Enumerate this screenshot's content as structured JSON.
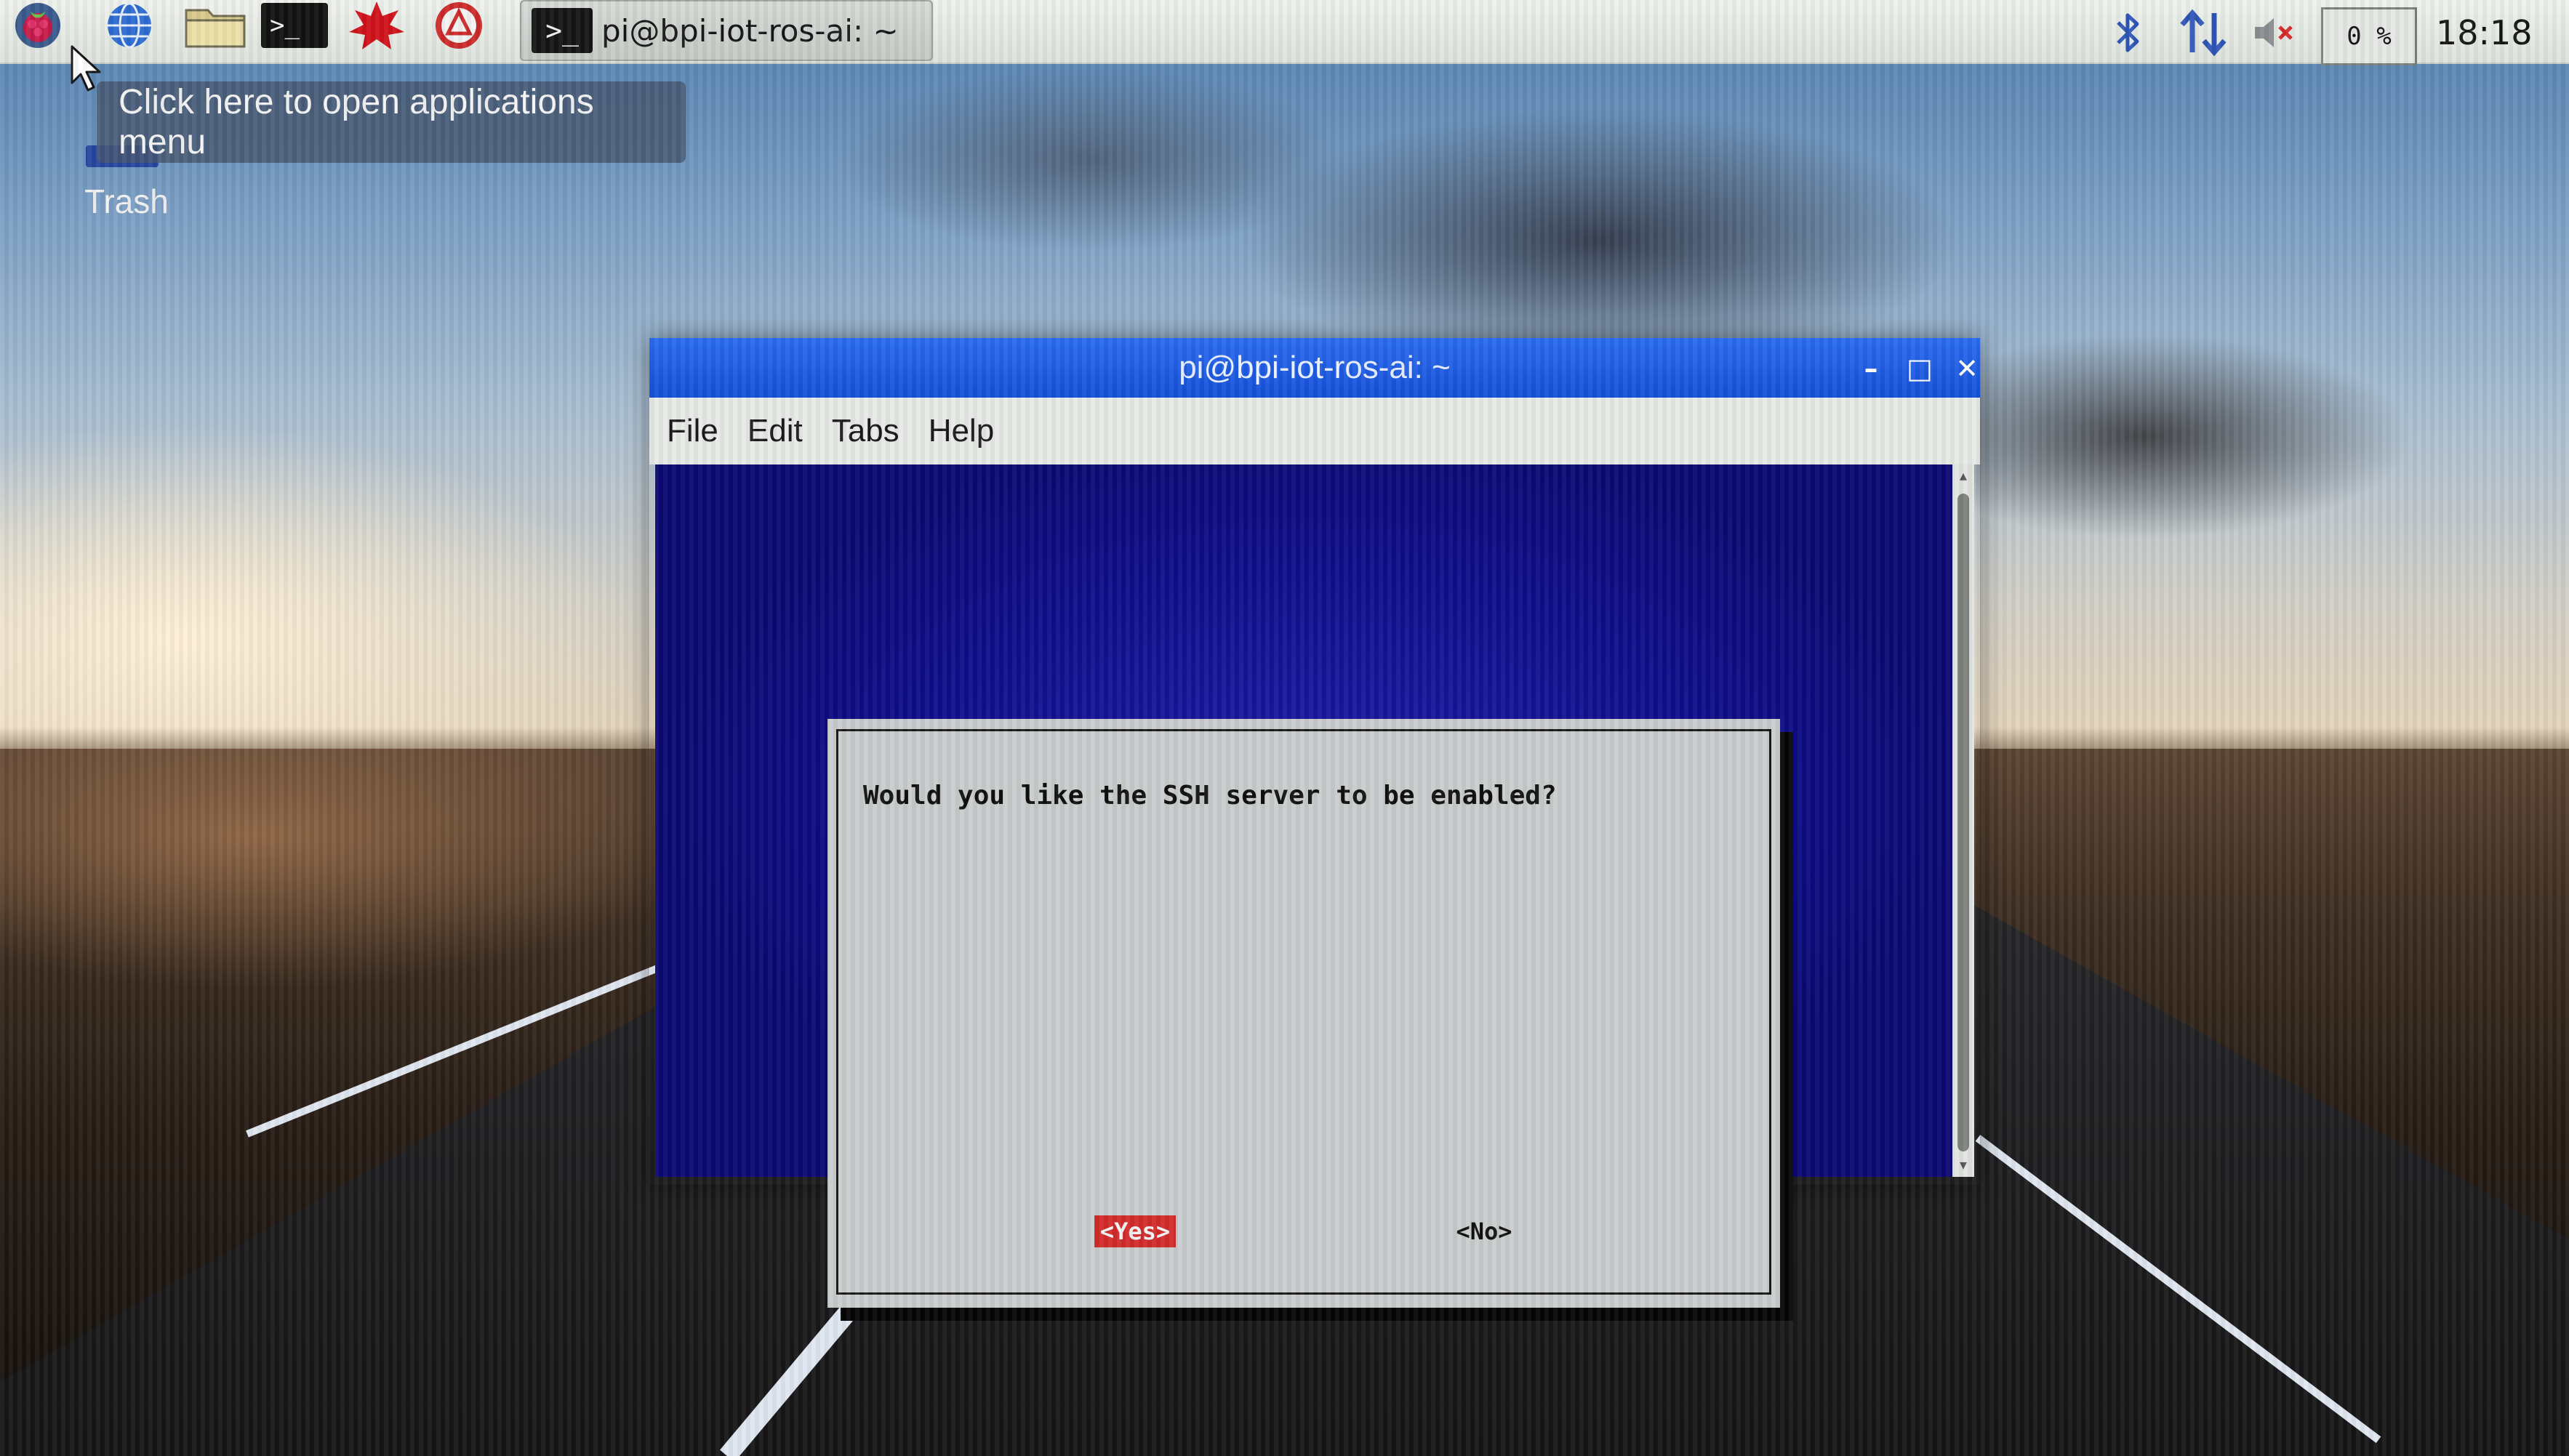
{
  "panel": {
    "launchers": [
      {
        "name": "raspberry-menu-icon"
      },
      {
        "name": "web-browser-icon"
      },
      {
        "name": "file-manager-icon"
      },
      {
        "name": "terminal-icon"
      },
      {
        "name": "math-app-icon"
      },
      {
        "name": "wolfram-icon"
      }
    ],
    "task": {
      "icon_glyph": ">_",
      "label": "pi@bpi-iot-ros-ai: ~"
    },
    "tray": {
      "bluetooth_icon": "bluetooth-icon",
      "network_icon": "network-arrows-icon",
      "volume_icon": "volume-muted-icon",
      "cpu_text": "0 %",
      "clock": "18:18"
    }
  },
  "desktop": {
    "tooltip": "Click here to open applications menu",
    "trash_label": "Trash"
  },
  "window": {
    "title": "pi@bpi-iot-ros-ai: ~",
    "controls": {
      "minimize": "–",
      "maximize": "□",
      "close": "✕"
    },
    "menu": [
      "File",
      "Edit",
      "Tabs",
      "Help"
    ],
    "dialog": {
      "message": "Would you like the SSH server to be enabled?",
      "yes": "<Yes>",
      "no": "<No>"
    }
  },
  "colors": {
    "terminal_bg": "#0e0c86",
    "titlebar": "#1a5ae0",
    "dialog_bg": "#c9cccd",
    "yes_button": "#d22b2b"
  }
}
